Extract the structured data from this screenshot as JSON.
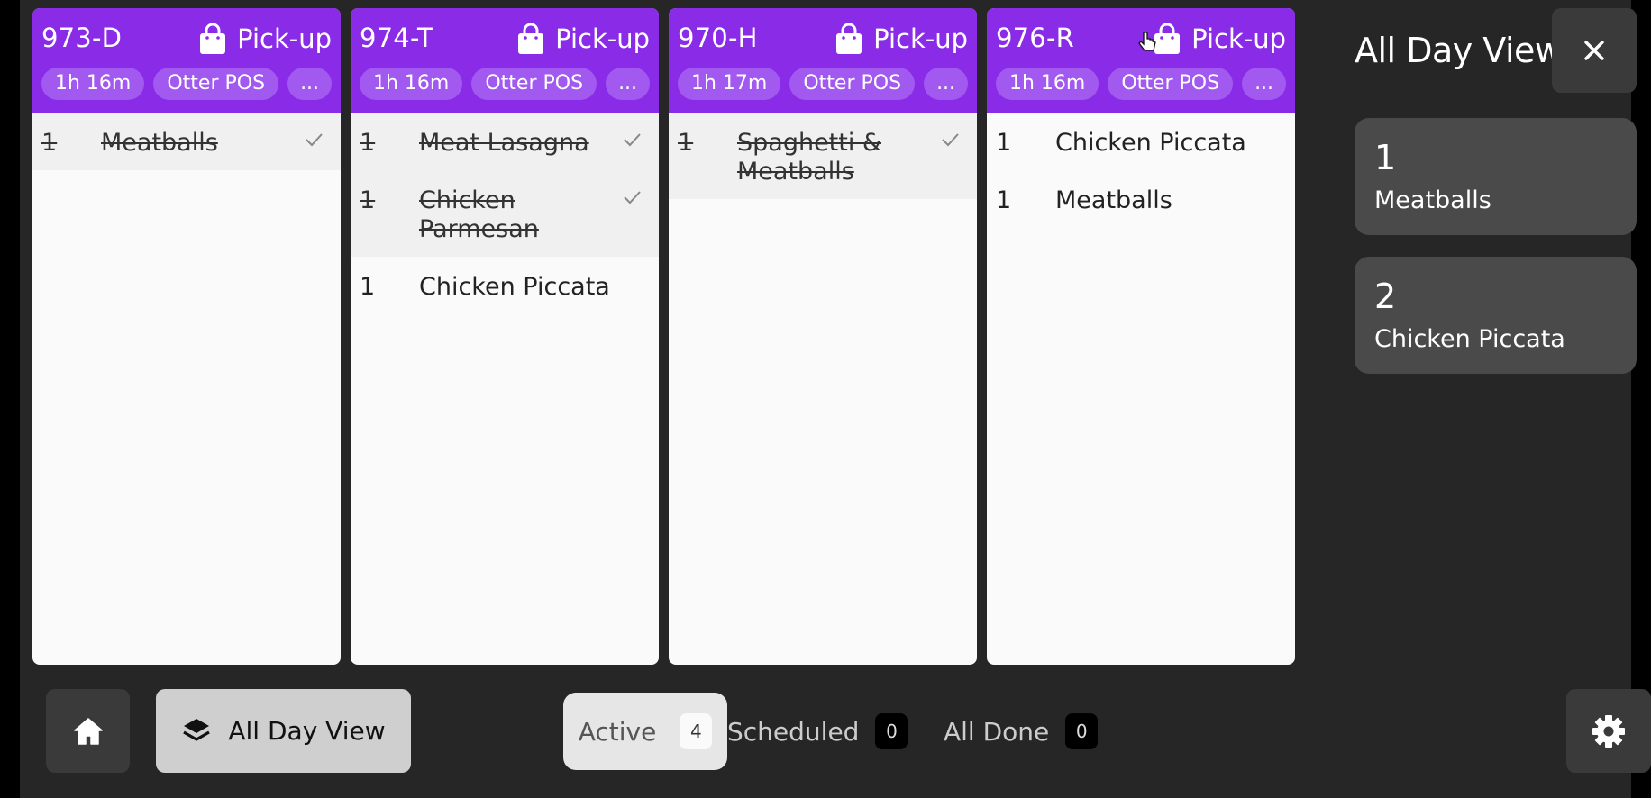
{
  "orders": [
    {
      "id": "973-D",
      "type": "Pick-up",
      "elapsed": "1h 16m",
      "source": "Otter POS",
      "more": "...",
      "items": [
        {
          "qty": "1",
          "name": "Meatballs",
          "done": true
        }
      ]
    },
    {
      "id": "974-T",
      "type": "Pick-up",
      "elapsed": "1h 16m",
      "source": "Otter POS",
      "more": "...",
      "items": [
        {
          "qty": "1",
          "name": "Meat Lasagna",
          "done": true
        },
        {
          "qty": "1",
          "name": "Chicken Parmesan",
          "done": true
        },
        {
          "qty": "1",
          "name": "Chicken Piccata",
          "done": false
        }
      ]
    },
    {
      "id": "970-H",
      "type": "Pick-up",
      "elapsed": "1h 17m",
      "source": "Otter POS",
      "more": "...",
      "items": [
        {
          "qty": "1",
          "name": "Spaghetti & Meatballs",
          "done": true
        }
      ]
    },
    {
      "id": "976-R",
      "type": "Pick-up",
      "elapsed": "1h 16m",
      "source": "Otter POS",
      "more": "...",
      "items": [
        {
          "qty": "1",
          "name": "Chicken Piccata",
          "done": false
        },
        {
          "qty": "1",
          "name": "Meatballs",
          "done": false
        }
      ]
    }
  ],
  "all_day_view": {
    "title": "All Day View",
    "items": [
      {
        "count": "1",
        "name": "Meatballs"
      },
      {
        "count": "2",
        "name": "Chicken Piccata"
      }
    ]
  },
  "bottom_bar": {
    "all_day_view_label": "All Day View",
    "tabs": [
      {
        "label": "Active",
        "count": "4",
        "selected": true
      },
      {
        "label": "Scheduled",
        "count": "0",
        "selected": false
      },
      {
        "label": "All Done",
        "count": "0",
        "selected": false
      }
    ]
  },
  "colors": {
    "header": "#8a2be8",
    "chip": "#a259f0",
    "background": "#262626"
  },
  "icons": [
    "shopping-bag-icon",
    "check-icon",
    "close-icon",
    "home-icon",
    "layers-icon",
    "gear-icon",
    "hand-pointer-icon"
  ]
}
